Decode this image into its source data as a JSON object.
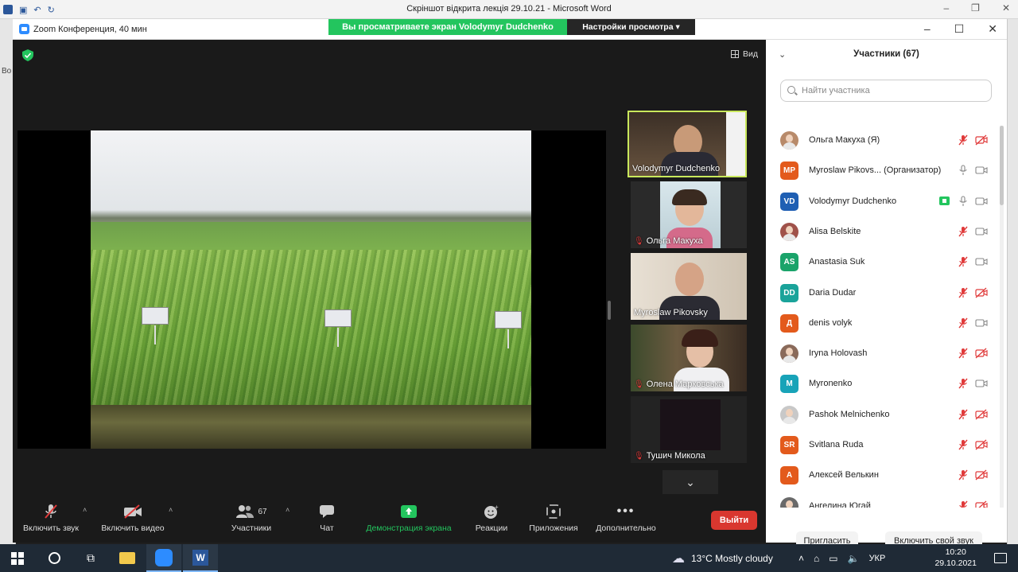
{
  "word": {
    "title": "Скріншот відкрита лекція 29.10.21  -  Microsoft Word",
    "side_text": "Во"
  },
  "zoom": {
    "app_title": "Zoom Конференция, 40 мин",
    "share_banner": "Вы просматриваете экран Volodymyr Dudchenko",
    "view_options": "Настройки просмотра",
    "view_button": "Вид"
  },
  "thumbnails": [
    {
      "name": "Volodymyr Dudchenko",
      "muted": false,
      "active": true
    },
    {
      "name": "Ольга Макуха",
      "muted": true,
      "active": false
    },
    {
      "name": "Myroslaw Pikovsky",
      "muted": false,
      "active": false
    },
    {
      "name": "Олена Марковська",
      "muted": true,
      "active": false
    },
    {
      "name": "Тушич Микола",
      "muted": true,
      "active": false
    }
  ],
  "toolbar": {
    "unmute": "Включить звук",
    "start_video": "Включить видео",
    "participants": "Участники",
    "participants_count": "67",
    "chat": "Чат",
    "share_screen": "Демонстрация экрана",
    "reactions": "Реакции",
    "apps": "Приложения",
    "more": "Дополнительно",
    "leave": "Выйти"
  },
  "panel": {
    "title": "Участники (67)",
    "search_placeholder": "Найти участника",
    "invite": "Пригласить",
    "unmute_me": "Включить свой звук",
    "participants": [
      {
        "name": "Ольга Макуха (Я)",
        "initials": "",
        "color": "#b88a6a",
        "photo": true,
        "mic_off": true,
        "cam_off": true
      },
      {
        "name": "Myroslaw Pikovs... (Организатор)",
        "initials": "MP",
        "color": "#e35a1c",
        "photo": false,
        "mic_off": false,
        "cam_off": false
      },
      {
        "name": "Volodymyr Dudchenko",
        "initials": "VD",
        "color": "#1f5fb3",
        "photo": false,
        "mic_off": false,
        "cam_off": false,
        "sharing": true
      },
      {
        "name": "Alisa Belskite",
        "initials": "",
        "color": "#a0524a",
        "photo": true,
        "mic_off": true,
        "cam_off": false
      },
      {
        "name": "Anastasia Suk",
        "initials": "AS",
        "color": "#1aa36a",
        "photo": false,
        "mic_off": true,
        "cam_off": false
      },
      {
        "name": "Daria Dudar",
        "initials": "DD",
        "color": "#1aa39a",
        "photo": false,
        "mic_off": true,
        "cam_off": true
      },
      {
        "name": "denis volyk",
        "initials": "Д",
        "color": "#e35a1c",
        "photo": false,
        "mic_off": true,
        "cam_off": false
      },
      {
        "name": "Iryna Holovash",
        "initials": "",
        "color": "#8a6a5a",
        "photo": true,
        "mic_off": true,
        "cam_off": true
      },
      {
        "name": "Myronenko",
        "initials": "M",
        "color": "#18a3b8",
        "photo": false,
        "mic_off": true,
        "cam_off": false
      },
      {
        "name": "Pashok Melnichenko",
        "initials": "",
        "color": "#c8c8c8",
        "photo": true,
        "mic_off": true,
        "cam_off": true
      },
      {
        "name": "Svitlana Ruda",
        "initials": "SR",
        "color": "#e35a1c",
        "photo": false,
        "mic_off": true,
        "cam_off": true
      },
      {
        "name": "Алексей Велькин",
        "initials": "A",
        "color": "#e35a1c",
        "photo": false,
        "mic_off": true,
        "cam_off": true
      },
      {
        "name": "Ангелина Югай",
        "initials": "",
        "color": "#6a6a6a",
        "photo": true,
        "mic_off": true,
        "cam_off": true
      }
    ]
  },
  "taskbar": {
    "weather": "13°C  Mostly cloudy",
    "language": "УКР",
    "time": "10:20",
    "date": "29.10.2021"
  }
}
